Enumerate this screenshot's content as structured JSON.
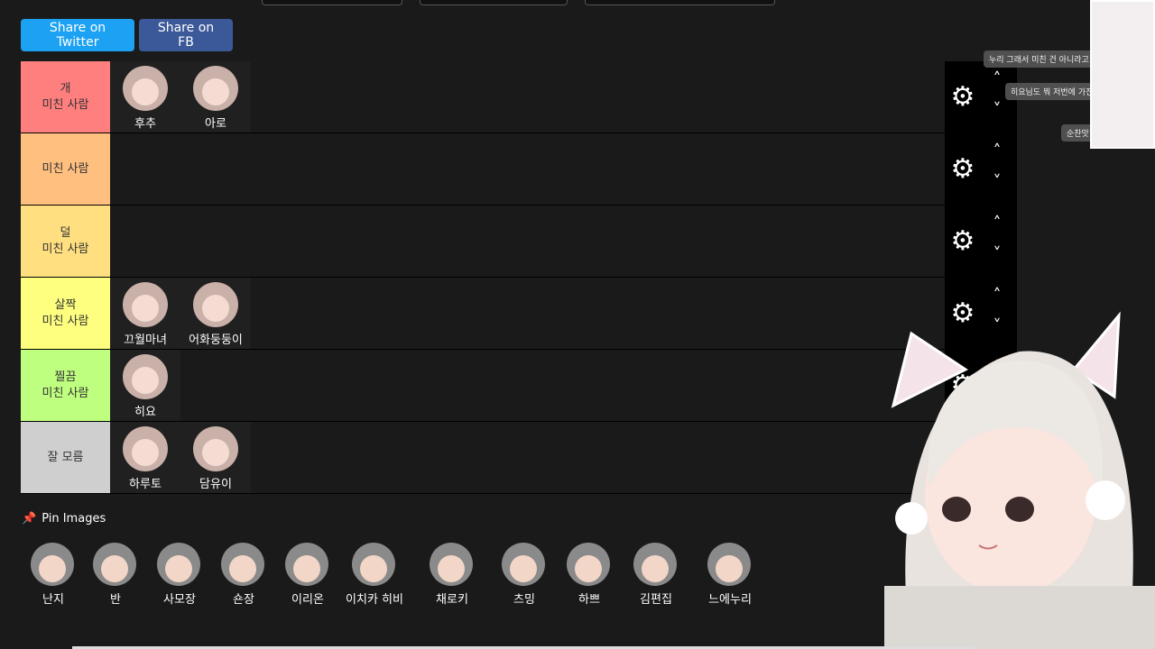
{
  "share": {
    "twitter_label": "Share on Twitter",
    "fb_label": "Share on FB",
    "twitter_color": "#1da1f2",
    "fb_color": "#3b5998"
  },
  "tiers": [
    {
      "label": "개\n미친 사람",
      "color": "#ff7f7f",
      "items": [
        "후추",
        "아로"
      ]
    },
    {
      "label": "미친 사람",
      "color": "#ffbf7f",
      "items": []
    },
    {
      "label": "덜\n미친 사람",
      "color": "#ffdf7f",
      "items": []
    },
    {
      "label": "살짝\n미친 사람",
      "color": "#ffff7f",
      "items": [
        "끄월마녀",
        "어화둥둥이"
      ]
    },
    {
      "label": "찔끔\n미친 사람",
      "color": "#bfff7f",
      "items": [
        "히요"
      ]
    },
    {
      "label": "잘 모름",
      "color": "#cfcfcf",
      "items": [
        "하루토",
        "담유이"
      ]
    }
  ],
  "controls": {
    "gear_icon": "gear-icon",
    "up_icon": "chevron-up-icon",
    "down_icon": "chevron-down-icon"
  },
  "pin": {
    "label": "Pin Images",
    "icon": "pushpin-icon",
    "items": [
      "난지",
      "반",
      "사모장",
      "숀장",
      "이리온",
      "이치카 히비",
      "채로키",
      "츠밍",
      "하쁘",
      "김편집",
      "느에누리"
    ]
  },
  "stream_chat": [
    "누리 그래서 미친 건 아니라고 나를 믿은 만",
    "히요님도 뭐 저번에 가진 잘 마는 미친",
    "순찬맛 하쁘이가는해"
  ]
}
